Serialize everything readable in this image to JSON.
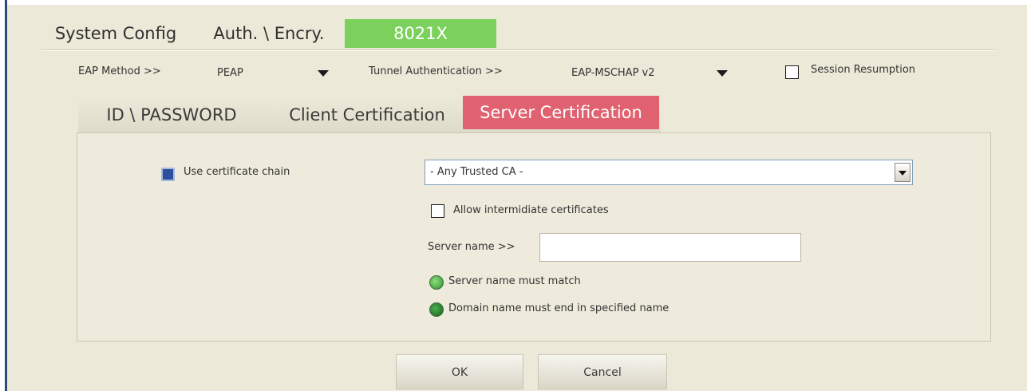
{
  "top_tabs": [
    {
      "label": "System Config",
      "active": false
    },
    {
      "label": "Auth. \\ Encry.",
      "active": false
    },
    {
      "label": "8021X",
      "active": true
    }
  ],
  "eap": {
    "method_label": "EAP Method >>",
    "method_value": "PEAP",
    "tunnel_label": "Tunnel Authentication >>",
    "tunnel_value": "EAP-MSCHAP v2",
    "session_resumption_label": "Session Resumption",
    "session_resumption_checked": false
  },
  "sub_tabs": [
    {
      "label": "ID \\ PASSWORD",
      "active": false
    },
    {
      "label": "Client Certification",
      "active": false
    },
    {
      "label": "Server Certification",
      "active": true
    }
  ],
  "server_cert": {
    "use_chain_label": "Use certificate chain",
    "use_chain_checked": true,
    "ca_select_value": "- Any Trusted CA -",
    "allow_intermediate_label": "Allow intermidiate certificates",
    "allow_intermediate_checked": false,
    "server_name_label": "Server name >>",
    "server_name_value": "",
    "radio_match_label": "Server name must match",
    "radio_domain_label": "Domain name must end in specified name"
  },
  "buttons": {
    "ok": "OK",
    "cancel": "Cancel"
  },
  "colors": {
    "active_top_tab": "#7bd15c",
    "active_sub_tab": "#e0616f",
    "dialog_bg": "#ece9d8"
  }
}
